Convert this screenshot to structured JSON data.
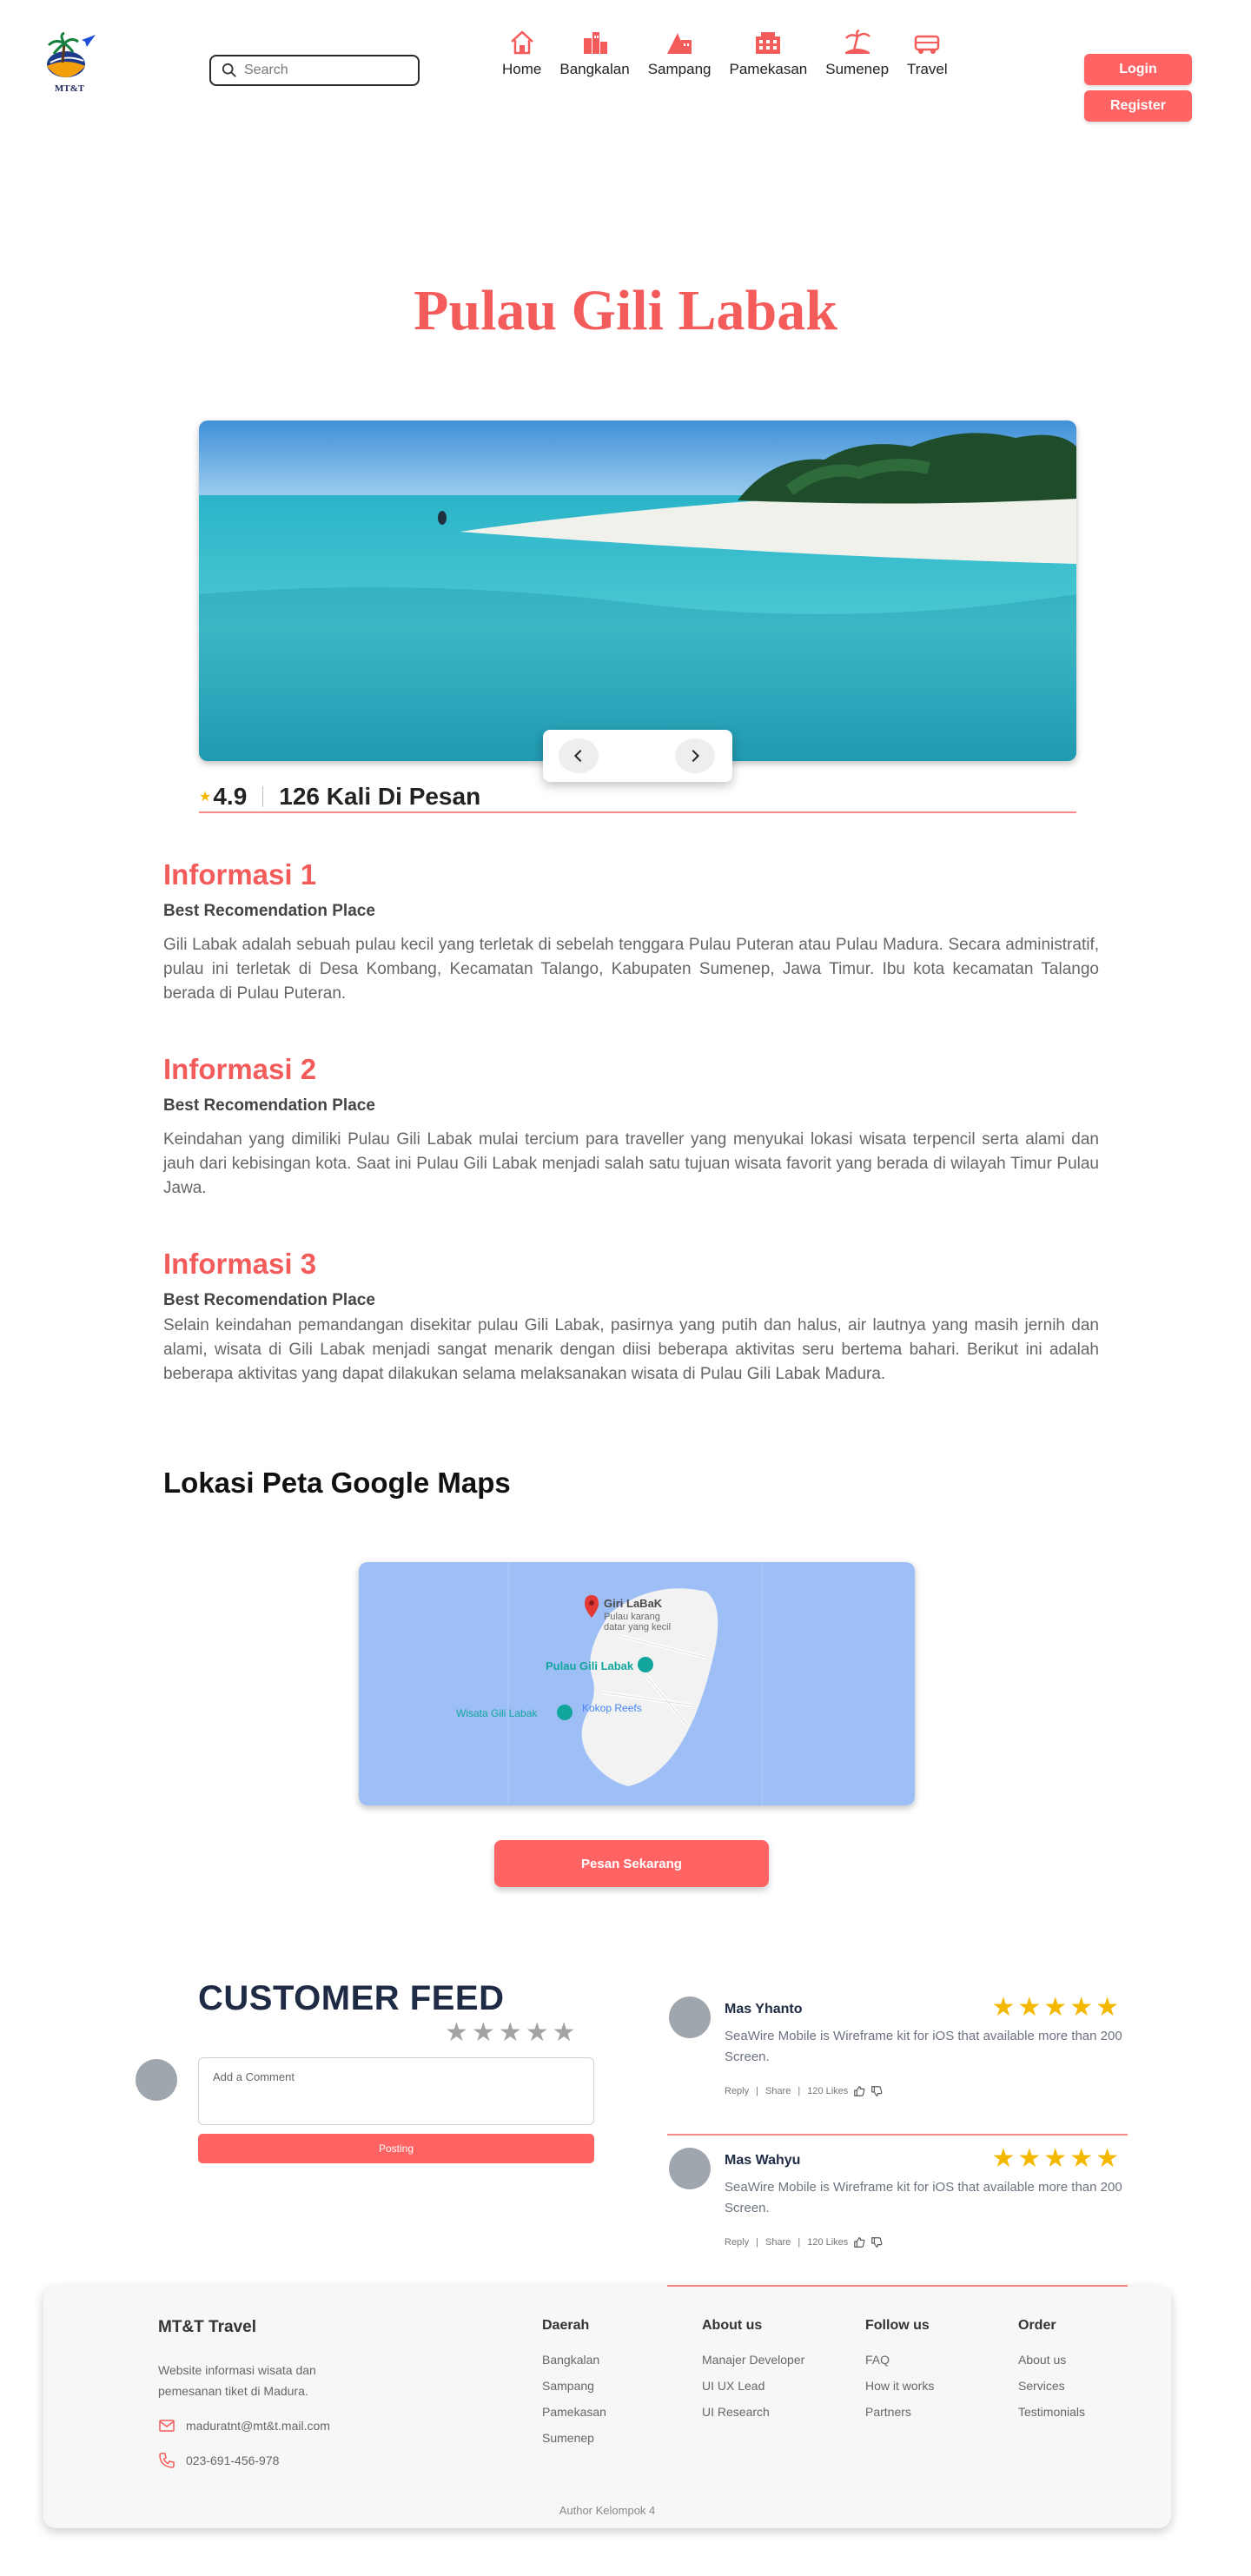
{
  "header": {
    "logo_text": "MT&T",
    "search_placeholder": "Search",
    "nav": [
      {
        "label": "Home",
        "icon": "home-icon"
      },
      {
        "label": "Bangkalan",
        "icon": "city-icon"
      },
      {
        "label": "Sampang",
        "icon": "buildings-icon"
      },
      {
        "label": "Pamekasan",
        "icon": "office-icon"
      },
      {
        "label": "Sumenep",
        "icon": "beach-icon"
      },
      {
        "label": "Travel",
        "icon": "bus-icon"
      }
    ],
    "login_label": "Login",
    "register_label": "Register"
  },
  "colors": {
    "accent": "#ff6363",
    "title": "#f45c5c",
    "star": "#f5b800",
    "dark": "#1f2b44"
  },
  "page": {
    "title": "Pulau Gili Labak"
  },
  "gallery": {
    "prev_icon": "chevron-left-icon",
    "next_icon": "chevron-right-icon"
  },
  "stats": {
    "star": "★",
    "rating": "4.9",
    "orders": "126 Kali Di Pesan"
  },
  "sections": [
    {
      "title": "Informasi 1",
      "subtitle": "Best Recomendation Place",
      "text": "Gili Labak adalah sebuah pulau kecil yang terletak di sebelah tenggara Pulau Puteran atau Pulau Madura. Secara administratif, pulau ini terletak di Desa Kombang, Kecamatan Talango, Kabupaten Sumenep, Jawa Timur. Ibu kota kecamatan Talango berada di Pulau Puteran."
    },
    {
      "title": "Informasi 2",
      "subtitle": "Best Recomendation Place",
      "text": "Keindahan yang dimiliki Pulau Gili Labak mulai tercium para traveller yang menyukai lokasi wisata terpencil serta alami dan jauh dari kebisingan kota. Saat ini Pulau Gili Labak menjadi salah satu tujuan wisata favorit yang berada di wilayah Timur Pulau Jawa."
    },
    {
      "title": "Informasi 3",
      "subtitle": "Best Recomendation Place",
      "text": "Selain keindahan pemandangan disekitar pulau Gili Labak, pasirnya yang putih dan halus, air lautnya yang masih jernih dan alami, wisata di Gili Labak menjadi sangat menarik dengan diisi beberapa aktivitas seru bertema bahari. Berikut ini adalah beberapa aktivitas yang dapat dilakukan selama melaksanakan wisata di Pulau Gili Labak Madura."
    }
  ],
  "maps": {
    "heading": "Lokasi Peta Google Maps",
    "pin_title": "Giri LaBaK",
    "pin_sub1": "Pulau karang",
    "pin_sub2": "datar yang kecil",
    "place1": "Pulau Gili Labak",
    "place2": "Kokop Reefs",
    "place3": "Wisata Gili Labak",
    "order_button": "Pesan Sekarang"
  },
  "feed": {
    "title": "CUSTOMER FEED",
    "rating_stars": 5,
    "comment_placeholder": "Add a Comment",
    "post_button": "Posting",
    "reviews": [
      {
        "name": "Mas Yhanto",
        "stars": 5,
        "text": "SeaWire Mobile is Wireframe kit for iOS that available more than 200 Screen.",
        "reply": "Reply",
        "share": "Share",
        "likes": "120 Likes"
      },
      {
        "name": "Mas Wahyu",
        "stars": 5,
        "text": "SeaWire Mobile is Wireframe kit for iOS that available more than 200 Screen.",
        "reply": "Reply",
        "share": "Share",
        "likes": "120 Likes"
      }
    ]
  },
  "footer": {
    "brand": "MT&T Travel",
    "desc": "Website informasi wisata dan pemesanan tiket di Madura.",
    "email": "maduratnt@mt&t.mail.com",
    "phone": "023-691-456-978",
    "columns": [
      {
        "title": "Daerah",
        "links": [
          "Bangkalan",
          "Sampang",
          "Pamekasan",
          "Sumenep"
        ]
      },
      {
        "title": "About us",
        "links": [
          "Manajer Developer",
          "UI UX Lead",
          "UI Research"
        ]
      },
      {
        "title": "Follow us",
        "links": [
          "FAQ",
          "How it works",
          "Partners"
        ]
      },
      {
        "title": "Order",
        "links": [
          "About us",
          "Services",
          "Testimonials"
        ]
      }
    ],
    "author": "Author Kelompok 4"
  }
}
